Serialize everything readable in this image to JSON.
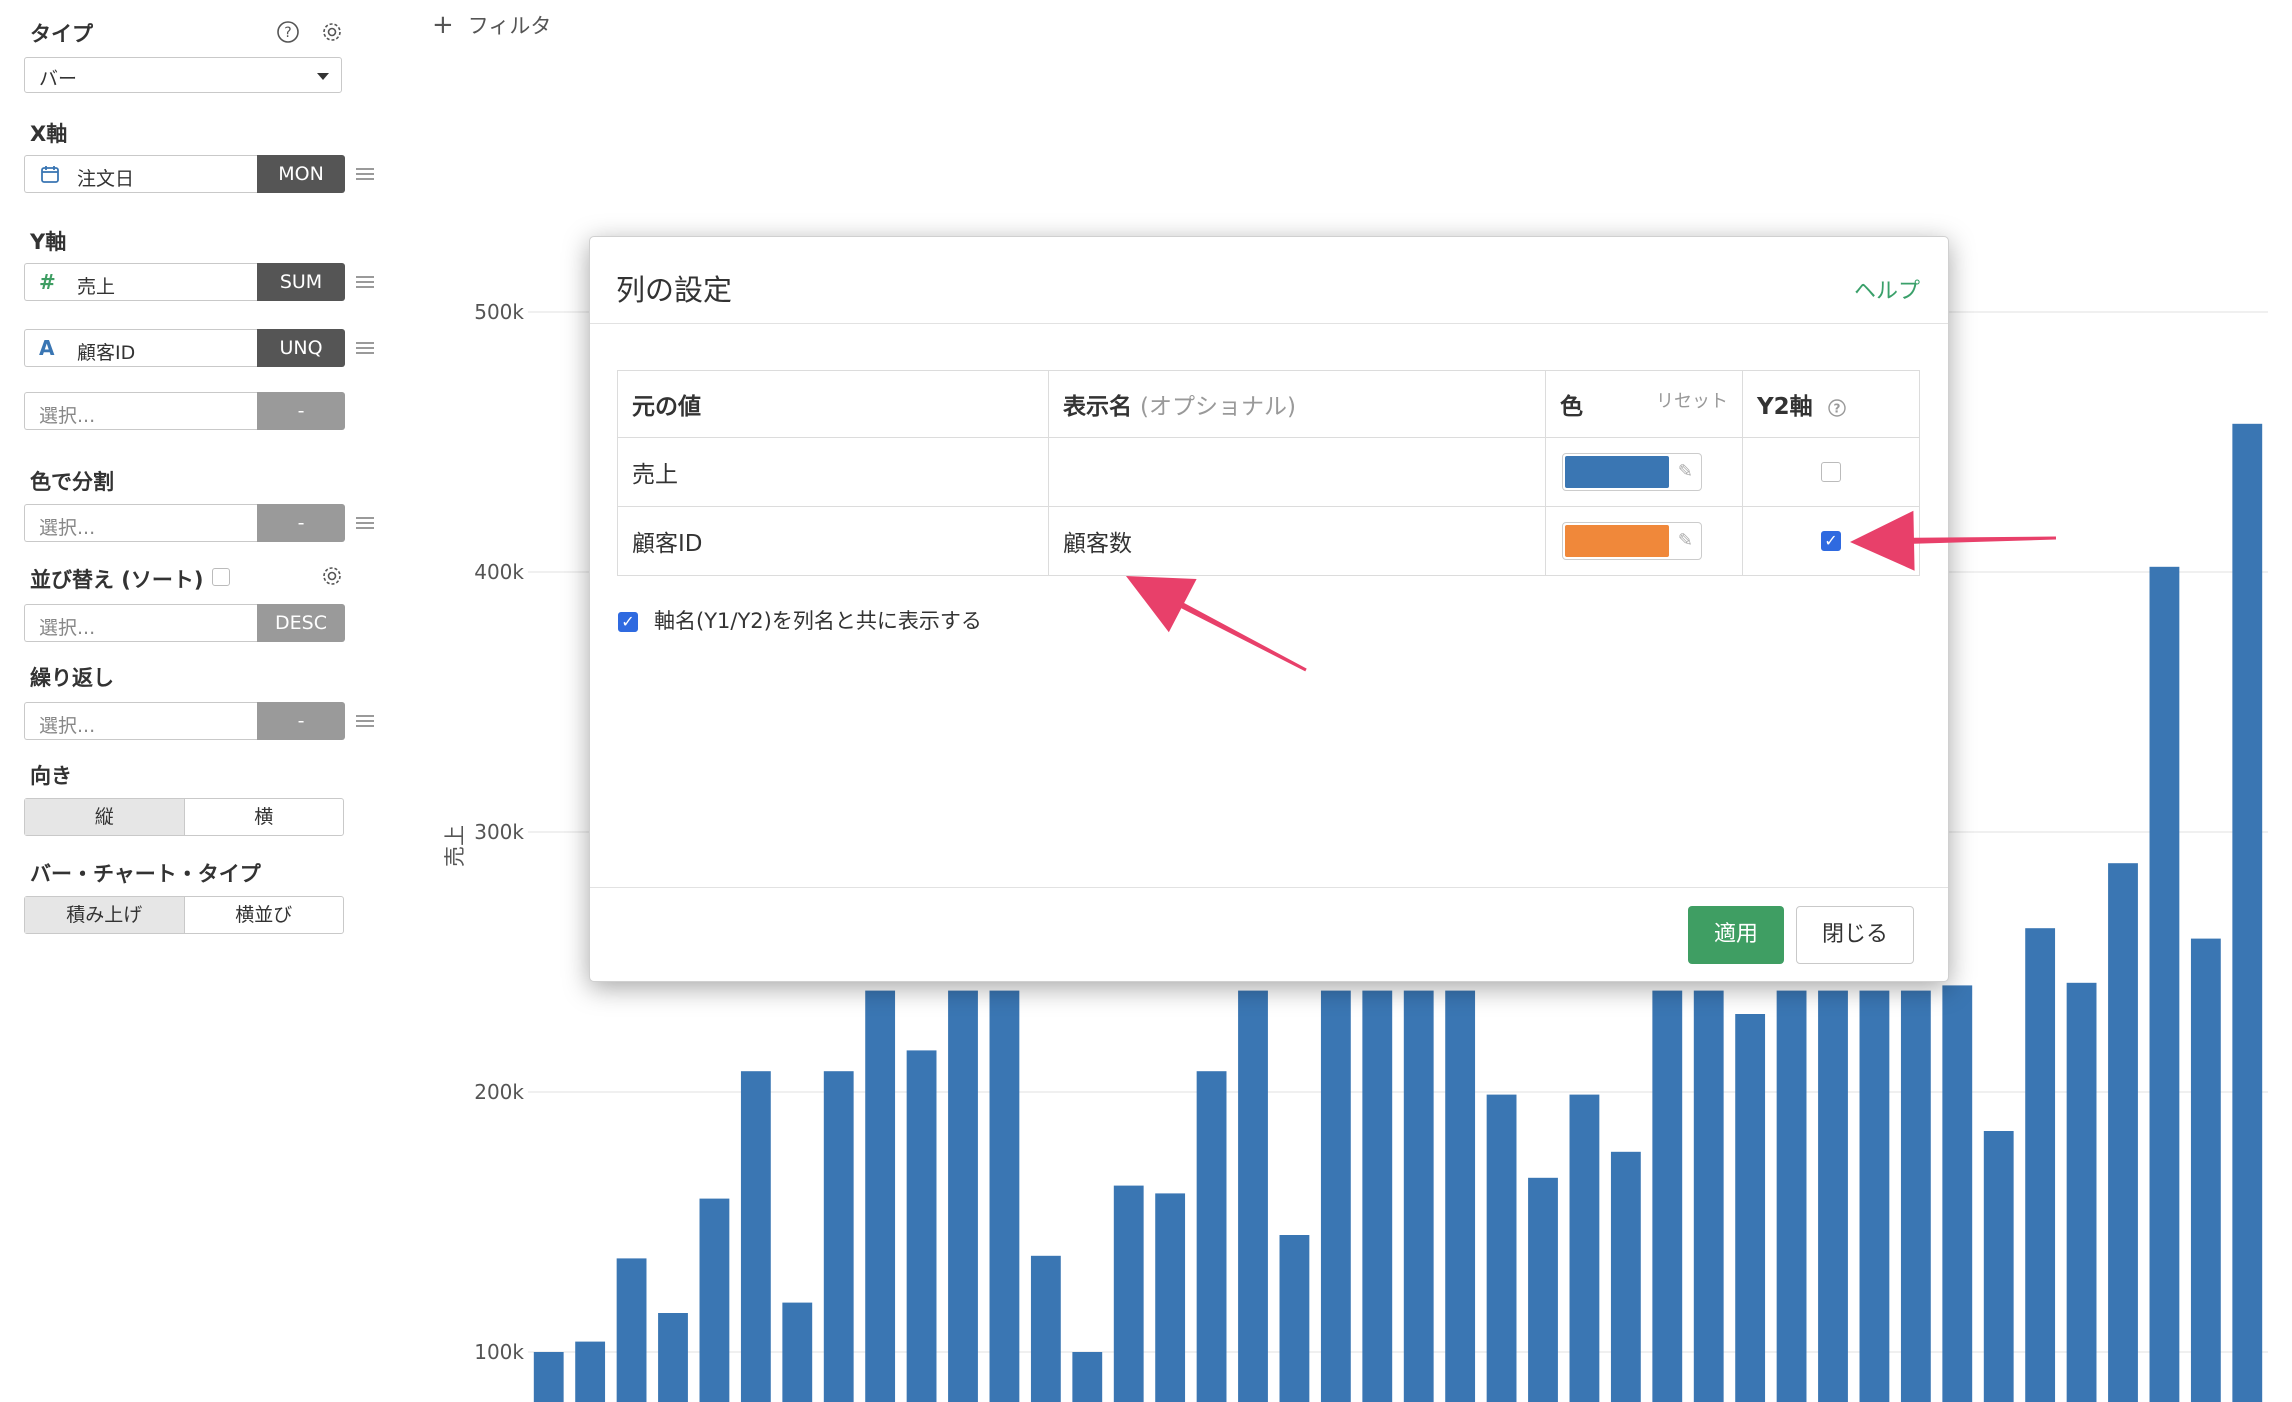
{
  "sidebar": {
    "type_label": "タイプ",
    "type_value": "バー",
    "x_axis_label": "X軸",
    "x_field": {
      "name": "注文日",
      "agg": "MON",
      "icon": "calendar-icon"
    },
    "y_axis_label": "Y軸",
    "y_fields": [
      {
        "icon_glyph": "#",
        "icon": "hash-icon",
        "name": "売上",
        "agg": "SUM"
      },
      {
        "icon_glyph": "A",
        "icon": "text-type-icon",
        "name": "顧客ID",
        "agg": "UNQ"
      }
    ],
    "y_add_placeholder": "選択...",
    "y_add_agg": "-",
    "color_split_label": "色で分割",
    "color_split_placeholder": "選択...",
    "color_split_agg": "-",
    "sort_label": "並び替え (ソート)",
    "sort_placeholder": "選択...",
    "sort_agg": "DESC",
    "repeat_label": "繰り返し",
    "repeat_placeholder": "選択...",
    "repeat_agg": "-",
    "direction_label": "向き",
    "direction_options": [
      "縦",
      "横"
    ],
    "bar_type_label": "バー・チャート・タイプ",
    "bar_type_options": [
      "積み上げ",
      "横並び"
    ]
  },
  "toolbar": {
    "filter_label": "フィルタ",
    "filter_icon": "plus-icon"
  },
  "chart_data": {
    "type": "bar",
    "ylabel": "売上",
    "ylim": [
      90000,
      520000
    ],
    "yticks": [
      "100k",
      "200k",
      "300k",
      "400k",
      "500k"
    ],
    "colors": {
      "bar": "#3a76b3"
    },
    "values": [
      100000,
      104000,
      136000,
      115000,
      159000,
      208000,
      119000,
      208000,
      239000,
      216000,
      239000,
      239000,
      137000,
      100000,
      164000,
      161000,
      208000,
      239000,
      145000,
      239000,
      239000,
      239000,
      239000,
      199000,
      167000,
      199000,
      177000,
      239000,
      239000,
      230000,
      239000,
      239000,
      239000,
      239000,
      241000,
      185000,
      263000,
      242000,
      288000,
      402000,
      259000,
      457000
    ]
  },
  "modal": {
    "title": "列の設定",
    "help_label": "ヘルプ",
    "headers": {
      "original": "元の値",
      "display": "表示名",
      "display_hint": "(オプショナル)",
      "color": "色",
      "reset": "リセット",
      "y2": "Y2軸"
    },
    "rows": [
      {
        "original": "売上",
        "display": "",
        "color": "#3a76b3",
        "y2": false
      },
      {
        "original": "顧客ID",
        "display": "顧客数",
        "color": "#f0883a",
        "y2": true
      }
    ],
    "show_axis_label": "軸名(Y1/Y2)を列名と共に表示する",
    "show_axis_checked": true,
    "apply_label": "適用",
    "close_label": "閉じる"
  },
  "annotations": {
    "arrow_color": "#e8406a"
  }
}
